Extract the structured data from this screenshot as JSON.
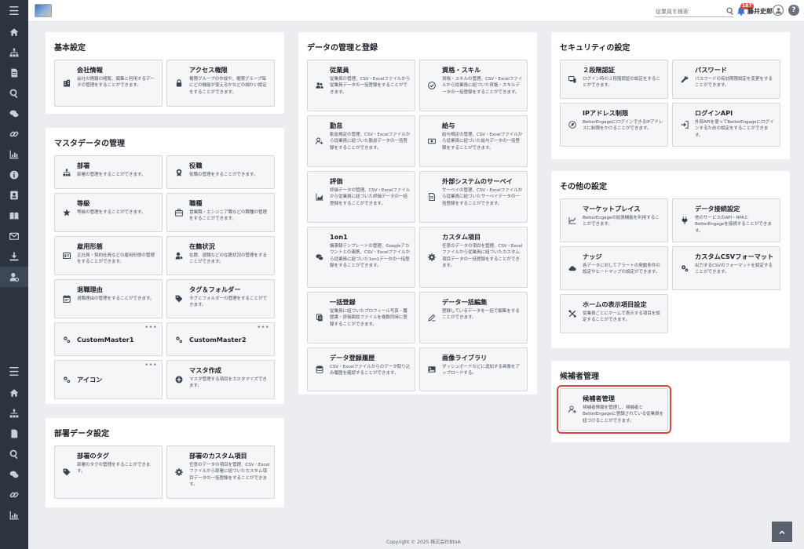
{
  "topbar": {
    "search_placeholder": "従業員を検索",
    "notification_count": "187",
    "username": "藤井史郎"
  },
  "sidebar": {
    "icons_top": [
      "menu-icon",
      "home-icon",
      "org-chart-icon",
      "document-icon",
      "search-icon",
      "chat-icon",
      "link-icon",
      "chart-icon",
      "info-icon",
      "id-card-icon",
      "book-icon",
      "mail-icon",
      "download-icon",
      "user-settings-icon"
    ],
    "icons_bottom": [
      "menu-icon",
      "home-icon",
      "org-chart-icon",
      "document-icon",
      "search-icon",
      "chat-icon",
      "link-icon",
      "chart-icon"
    ]
  },
  "sections": {
    "basic": {
      "title": "基本設定",
      "tiles": [
        {
          "title": "会社情報",
          "desc": "会社の情報の閲覧、編集と利用するデータの管理をすることができます。",
          "icon": "building-icon"
        },
        {
          "title": "アクセス権限",
          "desc": "権限グループの作成や、権限グループ毎にどの機能が使えるかなどの細かい設定をすることができます。",
          "icon": "lock-icon"
        }
      ]
    },
    "master": {
      "title": "マスタデータの管理",
      "tiles": [
        {
          "title": "部署",
          "desc": "部署の管理をすることができます。",
          "icon": "sitemap-icon"
        },
        {
          "title": "役職",
          "desc": "役職の管理をすることができます。",
          "icon": "badge-icon"
        },
        {
          "title": "等級",
          "desc": "等級の管理をすることができます。",
          "icon": "star-icon"
        },
        {
          "title": "職種",
          "desc": "営業職・エンジニア職などの職種の管理をすることができます。",
          "icon": "briefcase-icon"
        },
        {
          "title": "雇用形態",
          "desc": "正社員・契約社員などの雇用形態の管理をすることができます。",
          "icon": "id-card-icon"
        },
        {
          "title": "在籍状況",
          "desc": "在籍、退職などの在籍状況の管理をすることができます。",
          "icon": "user-status-icon"
        },
        {
          "title": "退職理由",
          "desc": "退職理由の管理をすることができます。",
          "icon": "calendar-icon"
        },
        {
          "title": "タグ＆フォルダー",
          "desc": "タグとフォルダーの管理をすることができます。",
          "icon": "tag-icon"
        },
        {
          "title": "CustomMaster1",
          "desc": "",
          "icon": "gears-icon",
          "more": "•••"
        },
        {
          "title": "CustomMaster2",
          "desc": "",
          "icon": "gears-icon",
          "more": "•••"
        },
        {
          "title": "アイコン",
          "desc": "",
          "icon": "gears-icon",
          "more": "•••"
        },
        {
          "title": "マスタ作成",
          "desc": "マスタ管理する項目をカスタマイズできます。",
          "icon": "plus-circle-icon"
        }
      ]
    },
    "dept": {
      "title": "部署データ設定",
      "tiles": [
        {
          "title": "部署のタグ",
          "desc": "部署のタグの管理をすることができます。",
          "icon": "tag-icon"
        },
        {
          "title": "部署のカスタム項目",
          "desc": "任意のデータの項目を管理、CSV・Excelファイルから部署に紐づいたカスタム項目データの一括登録をすることができます。",
          "icon": "gear-icon"
        }
      ]
    },
    "data": {
      "title": "データの管理と登録",
      "tiles": [
        {
          "title": "従業員",
          "desc": "従業員の管理、CSV・Excelファイルから従業員データの一括登録をすることができます。",
          "icon": "users-icon"
        },
        {
          "title": "資格・スキル",
          "desc": "資格・スキルの管理、CSV・Excelファイルから従業員に紐づいた資格・スキルデータの一括登録をすることができます。",
          "icon": "certificate-icon"
        },
        {
          "title": "勤怠",
          "desc": "勤怠規定の管理、CSV・Excelファイルから従業員に紐づいた勤怠データの一括登録をすることができます。",
          "icon": "user-plus-icon"
        },
        {
          "title": "給与",
          "desc": "給与規定の管理、CSV・Excelファイルから従業員に紐づいた給与データの一括登録をすることができます。",
          "icon": "money-icon"
        },
        {
          "title": "評価",
          "desc": "評価データの管理、CSV・Excelファイルから従業員に紐づいた評価データの一括登録をすることができます。",
          "icon": "chart-area-icon"
        },
        {
          "title": "外部システムのサーベイ",
          "desc": "サーベイの管理、CSV・Excelファイルから従業員に紐づいたサーベイデータの一括登録をすることができます。",
          "icon": "document-icon"
        },
        {
          "title": "1on1",
          "desc": "議事録テンプレートの管理、Googleアカウントとの連携、CSV・Excelファイルから従業員に紐づいた1on1データの一括登録をすることができます。",
          "icon": "comments-icon"
        },
        {
          "title": "カスタム項目",
          "desc": "任意のデータの項目を管理、CSV・Excelファイルから従業員に紐づいたカスタム項目データの一括登録をすることができます。",
          "icon": "gear-icon"
        },
        {
          "title": "一括登録",
          "desc": "従業員に紐づいたプロフィール写真・履歴書・評価面談ファイルを複数同時に登録することができます。",
          "icon": "files-icon"
        },
        {
          "title": "データ一括編集",
          "desc": "登録しているデータを一括で編集をすることができます。",
          "icon": "edit-icon"
        },
        {
          "title": "データ登録履歴",
          "desc": "CSV・Excelファイルからのデータ取り込み履歴を確認することができます。",
          "icon": "database-icon"
        },
        {
          "title": "画像ライブラリ",
          "desc": "ダッシュボードなどに追加する画像をアップロードする。",
          "icon": "image-icon"
        }
      ]
    },
    "security": {
      "title": "セキュリティの設定",
      "tiles": [
        {
          "title": "２段階認証",
          "desc": "ログイン時の２段階認証の設定をすることができます。",
          "icon": "devices-icon"
        },
        {
          "title": "パスワード",
          "desc": "パスワードの有効期限設定を変更をすることができます。",
          "icon": "wrench-icon"
        },
        {
          "title": "IPアドレス制限",
          "desc": "BetterEngageにログインできるIPアドレスに制限をかけることができます。",
          "icon": "location-icon"
        },
        {
          "title": "ログインAPI",
          "desc": "外部APIを使ってBetterEngageにログインするための設定をすることができます。",
          "icon": "sign-in-icon"
        }
      ]
    },
    "other": {
      "title": "その他の設定",
      "tiles": [
        {
          "title": "マーケットプレイス",
          "desc": "BetterEngageの拡張機能を利用することができます。",
          "icon": "line-chart-icon"
        },
        {
          "title": "データ接続設定",
          "desc": "他のサービスのAPI・RPAとBetterEngageを接続することができます。",
          "icon": "plug-icon"
        },
        {
          "title": "ナッジ",
          "desc": "各データに対してアラートの発動条件の設定やヒートマップの設定ができます。",
          "icon": "cloud-icon"
        },
        {
          "title": "カスタムCSVフォーマット",
          "desc": "出力するCSVのフォーマットを設定することができます。",
          "icon": "cogs-icon"
        },
        {
          "title": "ホームの表示項目設定",
          "desc": "従業員ごとにホームで表示する項目を設定することができます。",
          "icon": "tools-icon"
        }
      ]
    },
    "candidate": {
      "title": "候補者管理",
      "tiles": [
        {
          "title": "候補者管理",
          "desc": "候補者情報を管理し、候補者とBetterEngageに登録されている従業員を紐づけることができます。",
          "icon": "user-gear-icon"
        }
      ]
    }
  },
  "footer": {
    "copyright": "Copyright © 2025 株式会社BtoA"
  },
  "colors": {
    "highlight": "#d9453b",
    "rail": "#2c3440",
    "tile_bg": "#f5f6f8"
  }
}
